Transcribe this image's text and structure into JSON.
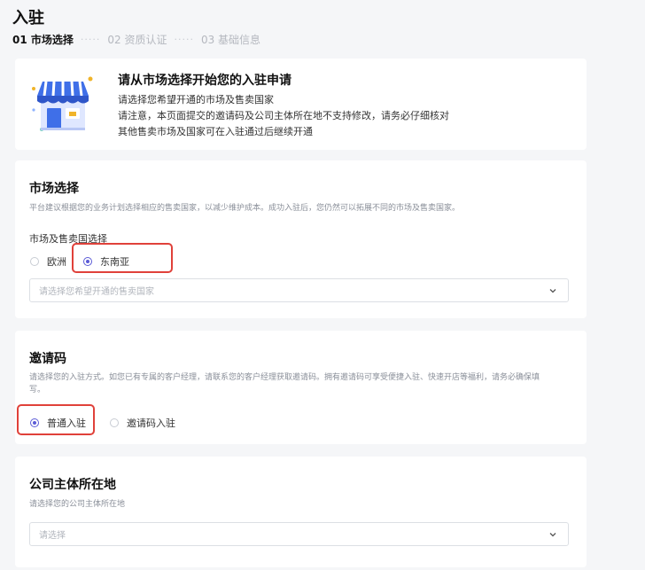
{
  "page": {
    "title": "入驻",
    "steps": [
      {
        "label": "01 市场选择",
        "active": true
      },
      {
        "label": "02 资质认证",
        "active": false
      },
      {
        "label": "03 基础信息",
        "active": false
      }
    ]
  },
  "intro": {
    "title": "请从市场选择开始您的入驻申请",
    "lines": [
      "请选择您希望开通的市场及售卖国家",
      "请注意，本页面提交的邀请码及公司主体所在地不支持修改，请务必仔细核对",
      "其他售卖市场及国家可在入驻通过后继续开通"
    ],
    "icon": "storefront-illustration"
  },
  "market": {
    "title": "市场选择",
    "desc": "平台建议根据您的业务计划选择相应的售卖国家，以减少维护成本。成功入驻后，您仍然可以拓展不同的市场及售卖国家。",
    "field_label": "市场及售卖国选择",
    "options": [
      {
        "label": "欧洲",
        "checked": false
      },
      {
        "label": "东南亚",
        "checked": true
      }
    ],
    "country_placeholder": "请选择您希望开通的售卖国家"
  },
  "invite": {
    "title": "邀请码",
    "desc_line1": "请选择您的入驻方式。如您已有专属的客户经理，请联系您的客户经理获取邀请码。拥有邀请码可享受便捷入驻、快速开店等福利，请务必确保填",
    "desc_line2": "写。",
    "options": [
      {
        "label": "普通入驻",
        "checked": true
      },
      {
        "label": "邀请码入驻",
        "checked": false
      }
    ]
  },
  "company": {
    "title": "公司主体所在地",
    "desc": "请选择您的公司主体所在地",
    "placeholder": "请选择"
  },
  "colors": {
    "accent": "#5b5bd6",
    "highlight": "#e0413a",
    "background": "#f5f6f8"
  }
}
